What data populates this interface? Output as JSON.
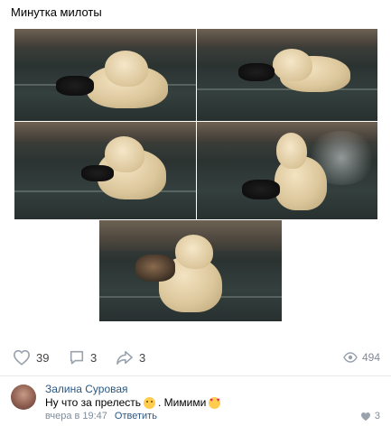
{
  "post": {
    "text": "Минутка милоты"
  },
  "actions": {
    "likes": "39",
    "comments": "3",
    "shares": "3",
    "views": "494"
  },
  "comment": {
    "author": "Залина Суровая",
    "text_part1": "Ну что за прелесть",
    "text_part2": ". Мимими",
    "time": "вчера в 19:47",
    "reply_label": "Ответить",
    "likes": "3"
  },
  "icons": {
    "like": "heart-icon",
    "comment": "comment-icon",
    "share": "share-icon",
    "views": "eye-icon",
    "comment_like": "heart-icon"
  },
  "colors": {
    "link": "#2a5885",
    "muted": "#818c99",
    "icon": "#99a2ad"
  }
}
